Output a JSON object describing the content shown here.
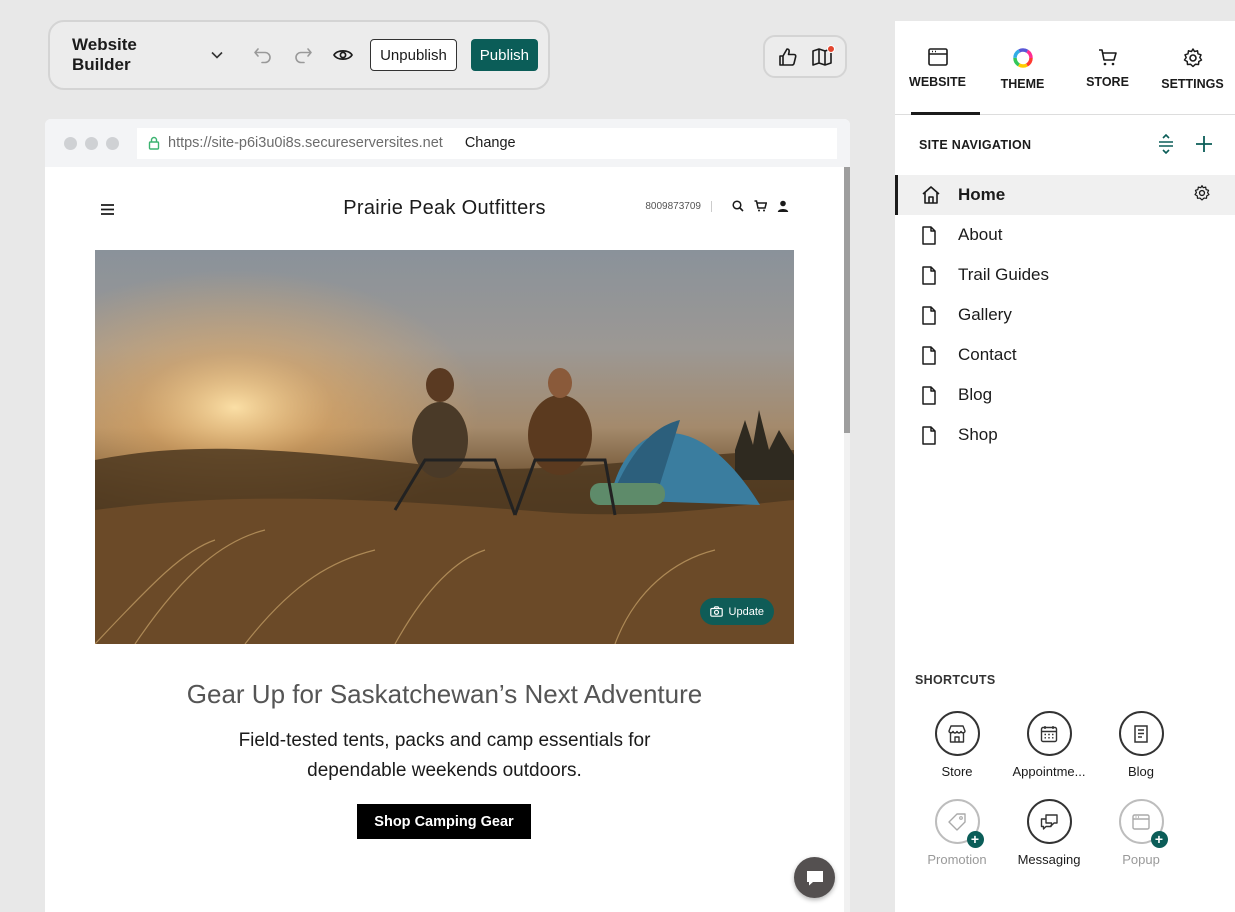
{
  "toolbar": {
    "title": "Website Builder",
    "unpublish_label": "Unpublish",
    "publish_label": "Publish",
    "icons": [
      "chevron-down-icon",
      "undo-icon",
      "redo-icon",
      "preview-eye-icon"
    ]
  },
  "mini_toolbar": {
    "icons": [
      "thumbs-up-icon",
      "map-icon"
    ]
  },
  "browser": {
    "url": "https://site-p6i3u0i8s.secureserversites.net",
    "change_label": "Change"
  },
  "site": {
    "name": "Prairie Peak Outfitters",
    "phone": "8009873709",
    "hero_update_label": "Update",
    "headline": "Gear Up for Saskatchewan’s Next Adventure",
    "subline_1": "Field-tested tents, packs and camp essentials for",
    "subline_2": "dependable weekends outdoors.",
    "cta_label": "Shop Camping Gear"
  },
  "panel": {
    "tabs": [
      {
        "label": "WEBSITE",
        "icon": "browser-window-icon"
      },
      {
        "label": "THEME",
        "icon": "color-wheel-icon"
      },
      {
        "label": "STORE",
        "icon": "cart-icon"
      },
      {
        "label": "SETTINGS",
        "icon": "gear-icon"
      }
    ],
    "nav_title": "SITE NAVIGATION",
    "nav_items": [
      {
        "label": "Home"
      },
      {
        "label": "About"
      },
      {
        "label": "Trail Guides"
      },
      {
        "label": "Gallery"
      },
      {
        "label": "Contact"
      },
      {
        "label": "Blog"
      },
      {
        "label": "Shop"
      }
    ],
    "shortcuts_title": "SHORTCUTS",
    "shortcuts": [
      {
        "label": "Store"
      },
      {
        "label": "Appointme..."
      },
      {
        "label": "Blog"
      },
      {
        "label": "Promotion"
      },
      {
        "label": "Messaging"
      },
      {
        "label": "Popup"
      }
    ]
  },
  "colors": {
    "accent": "#0b5d58",
    "notification": "#e2462f"
  }
}
